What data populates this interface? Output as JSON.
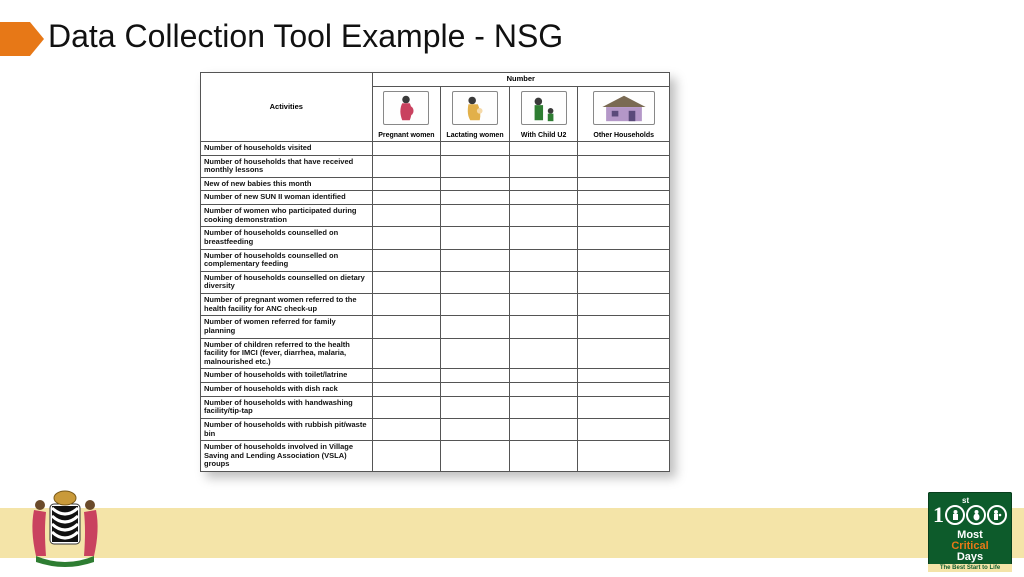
{
  "title": "Data Collection Tool Example - NSG",
  "table": {
    "activities_header": "Activities",
    "number_header": "Number",
    "columns": [
      {
        "label": "Pregnant women"
      },
      {
        "label": "Lactating women"
      },
      {
        "label": "With Child U2"
      },
      {
        "label": "Other Households"
      }
    ],
    "rows": [
      "Number of households visited",
      "Number of households that have received monthly lessons",
      "New of new babies this month",
      "Number of new SUN II woman identified",
      "Number of women who participated during cooking demonstration",
      "Number of households counselled on breastfeeding",
      "Number of households counselled on complementary feeding",
      "Number of households counselled on dietary diversity",
      "Number of pregnant women referred to the health facility for ANC check-up",
      "Number of women referred for family planning",
      "Number of children referred to the health facility for IMCI (fever, diarrhea, malaria, malnourished etc.)",
      "Number of households with toilet/latrine",
      "Number of households with dish rack",
      "Number of households with handwashing facility/tip-tap",
      "Number of households with rubbish pit/waste bin",
      "Number of households involved in Village Saving and Lending Association (VSLA) groups"
    ]
  },
  "logo": {
    "sup": "st",
    "digit": "1",
    "most": "Most",
    "critical": "Critical",
    "days": "Days",
    "tagline": "The Best Start to Life"
  }
}
